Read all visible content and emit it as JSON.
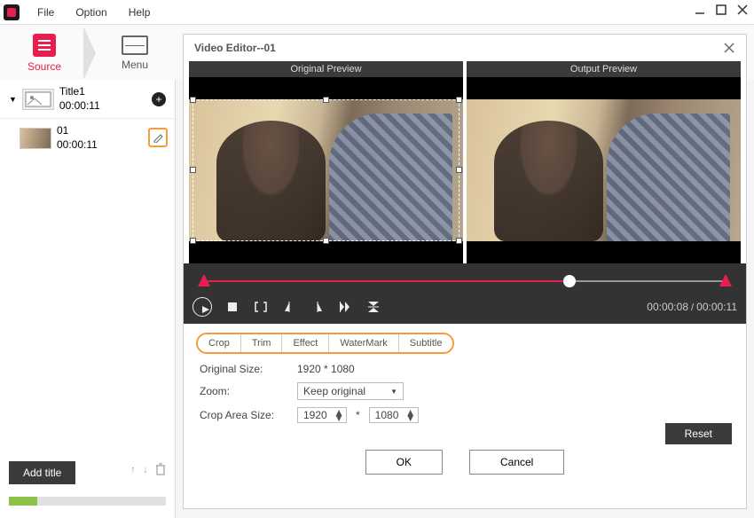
{
  "menubar": {
    "items": [
      "File",
      "Option",
      "Help"
    ]
  },
  "top_tabs": {
    "source": "Source",
    "menu": "Menu"
  },
  "sidebar": {
    "title_item": {
      "name": "Title1",
      "duration": "00:00:11"
    },
    "clip_item": {
      "name": "01",
      "duration": "00:00:11"
    },
    "add_title": "Add title"
  },
  "editor": {
    "title": "Video Editor--01",
    "preview_labels": {
      "original": "Original Preview",
      "output": "Output Preview"
    },
    "time": {
      "current": "00:00:08",
      "total": "00:00:11"
    },
    "tabs": [
      "Crop",
      "Trim",
      "Effect",
      "WaterMark",
      "Subtitle"
    ],
    "form": {
      "original_size_label": "Original Size:",
      "original_size_value": "1920 * 1080",
      "zoom_label": "Zoom:",
      "zoom_value": "Keep original",
      "crop_area_label": "Crop Area Size:",
      "crop_w": "1920",
      "crop_h": "1080",
      "asterisk": "*"
    },
    "buttons": {
      "reset": "Reset",
      "ok": "OK",
      "cancel": "Cancel"
    }
  }
}
